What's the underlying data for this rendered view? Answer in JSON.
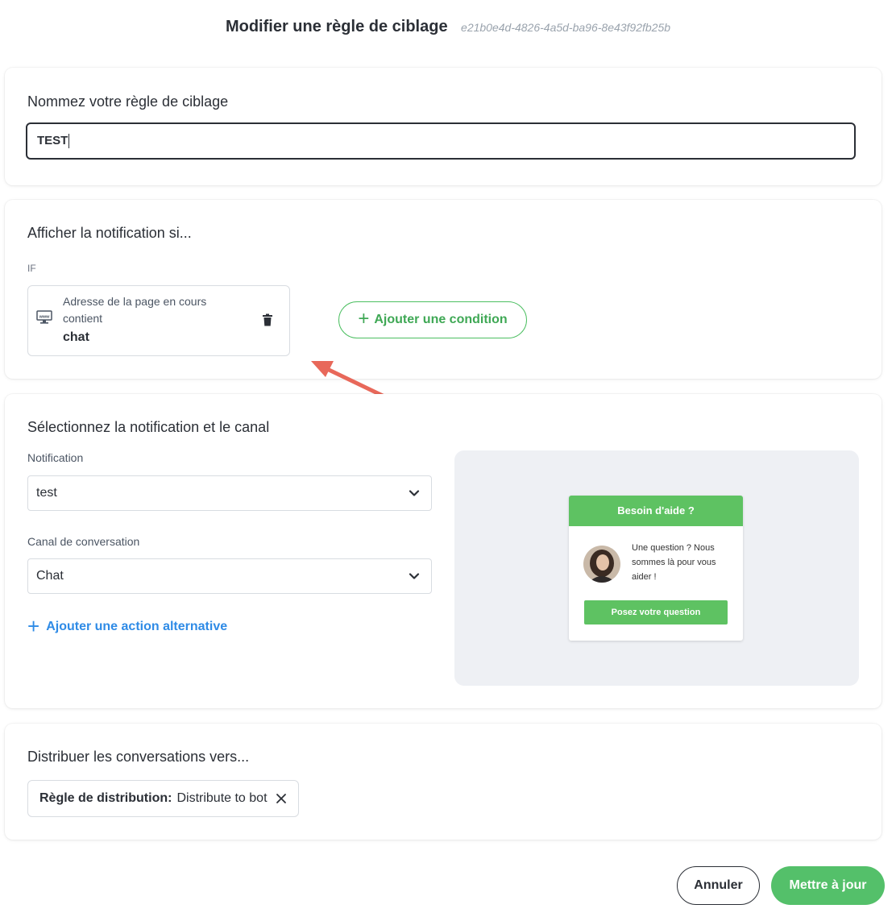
{
  "header": {
    "title": "Modifier une règle de ciblage",
    "rule_id": "e21b0e4d-4826-4a5d-ba96-8e43f92fb25b"
  },
  "name_section": {
    "title": "Nommez votre règle de ciblage",
    "input_value": "TEST"
  },
  "conditions_section": {
    "title": "Afficher la notification si...",
    "if_label": "IF",
    "condition": {
      "icon": "www-icon",
      "line1": "Adresse de la page en cours",
      "line2": "contient",
      "value": "chat"
    },
    "add_condition_label": "Ajouter une condition"
  },
  "notification_section": {
    "title": "Sélectionnez la notification et le canal",
    "notification_label": "Notification",
    "notification_value": "test",
    "channel_label": "Canal de conversation",
    "channel_value": "Chat",
    "alt_action_label": "Ajouter une action alternative",
    "preview": {
      "header": "Besoin d'aide ?",
      "message": "Une question ? Nous sommes là pour vous aider !",
      "button": "Posez votre question"
    }
  },
  "distribution_section": {
    "title": "Distribuer les conversations vers...",
    "tag_label": "Règle de distribution:",
    "tag_value": "Distribute to bot"
  },
  "footer": {
    "cancel_label": "Annuler",
    "update_label": "Mettre à jour"
  },
  "colors": {
    "accent_green": "#54c06a",
    "link_blue": "#2f8be6",
    "arrow_red": "#e8685a"
  }
}
